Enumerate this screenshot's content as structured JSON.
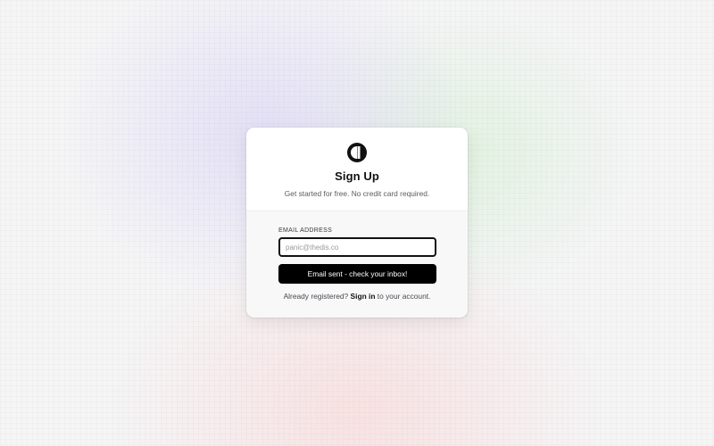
{
  "page": {
    "background_accents": [
      "#d4cdf5",
      "#d2f0d0",
      "#fad4d4"
    ]
  },
  "logo": {
    "icon": "brand-logo-icon",
    "color": "#111111"
  },
  "header": {
    "title": "Sign Up",
    "subtitle": "Get started for free. No credit card required."
  },
  "form": {
    "email_label": "EMAIL ADDRESS",
    "email_placeholder": "panic@thedis.co",
    "email_value": "",
    "submit_label": "Email sent - check your inbox!"
  },
  "footer": {
    "prefix": "Already registered?",
    "link_label": "Sign in",
    "suffix": "to your account."
  }
}
